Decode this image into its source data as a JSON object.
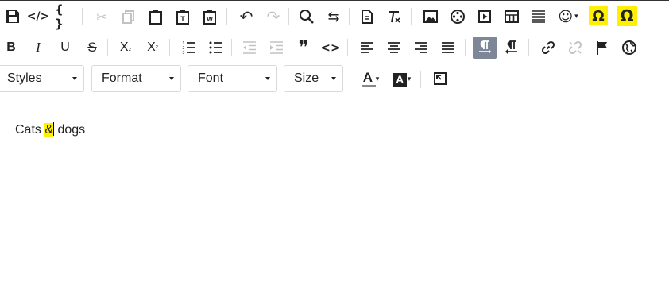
{
  "toolbar": {
    "row1": [
      {
        "name": "save-icon",
        "glyph": "💾"
      },
      {
        "name": "source-code-icon",
        "glyph": "</>"
      },
      {
        "name": "code-sample-icon",
        "glyph": "{ }"
      },
      {
        "name": "cut-icon",
        "glyph": "✂"
      },
      {
        "name": "copy-icon",
        "glyph": "⧉"
      },
      {
        "name": "paste-icon",
        "glyph": "📋"
      },
      {
        "name": "paste-text-icon",
        "glyph": "T"
      },
      {
        "name": "paste-word-icon",
        "glyph": "W"
      },
      {
        "name": "undo-icon",
        "glyph": "↶"
      },
      {
        "name": "redo-icon",
        "glyph": "↷"
      },
      {
        "name": "find-icon",
        "glyph": "⌕"
      },
      {
        "name": "replace-icon",
        "glyph": "⇆"
      },
      {
        "name": "new-document-icon",
        "glyph": "🗎"
      },
      {
        "name": "remove-format-icon",
        "glyph": "T̸"
      },
      {
        "name": "image-icon",
        "glyph": "🖼"
      },
      {
        "name": "media-icon",
        "glyph": "◎"
      },
      {
        "name": "video-icon",
        "glyph": "▶"
      },
      {
        "name": "table-icon",
        "glyph": "⊞"
      },
      {
        "name": "horizontal-rule-icon",
        "glyph": "☰"
      },
      {
        "name": "emoji-icon",
        "glyph": "☺"
      },
      {
        "name": "special-char-icon",
        "glyph": "Ω"
      },
      {
        "name": "special-char-bold-icon",
        "glyph": "Ω"
      }
    ],
    "row2": [
      {
        "name": "bold-icon",
        "glyph": "B"
      },
      {
        "name": "italic-icon",
        "glyph": "I"
      },
      {
        "name": "underline-icon",
        "glyph": "U"
      },
      {
        "name": "strikethrough-icon",
        "glyph": "S"
      },
      {
        "name": "subscript-icon",
        "glyph": "X₂"
      },
      {
        "name": "superscript-icon",
        "glyph": "X²"
      },
      {
        "name": "numbered-list-icon",
        "glyph": "≡"
      },
      {
        "name": "bullet-list-icon",
        "glyph": "≡"
      },
      {
        "name": "outdent-icon",
        "glyph": "⇤"
      },
      {
        "name": "indent-icon",
        "glyph": "⇥"
      },
      {
        "name": "blockquote-icon",
        "glyph": "❞"
      },
      {
        "name": "inline-code-icon",
        "glyph": "<>"
      },
      {
        "name": "align-left-icon",
        "glyph": "≡"
      },
      {
        "name": "align-center-icon",
        "glyph": "≡"
      },
      {
        "name": "align-right-icon",
        "glyph": "≡"
      },
      {
        "name": "justify-icon",
        "glyph": "≡"
      },
      {
        "name": "ltr-icon",
        "glyph": "¶"
      },
      {
        "name": "rtl-icon",
        "glyph": "¶"
      },
      {
        "name": "link-icon",
        "glyph": "🔗"
      },
      {
        "name": "unlink-icon",
        "glyph": "⛓"
      },
      {
        "name": "anchor-flag-icon",
        "glyph": "⚑"
      },
      {
        "name": "globe-icon",
        "glyph": "🌐"
      }
    ],
    "combos": {
      "styles": "Styles",
      "format": "Format",
      "font": "Font",
      "size": "Size"
    },
    "text_color_icon": "A",
    "bg_color_icon": "A",
    "fullscreen_icon": "⛶"
  },
  "editor": {
    "before": "Cats ",
    "selected": "&",
    "after": " dogs"
  },
  "colors": {
    "highlight": "#ffef00",
    "active_button": "#7e8797"
  }
}
